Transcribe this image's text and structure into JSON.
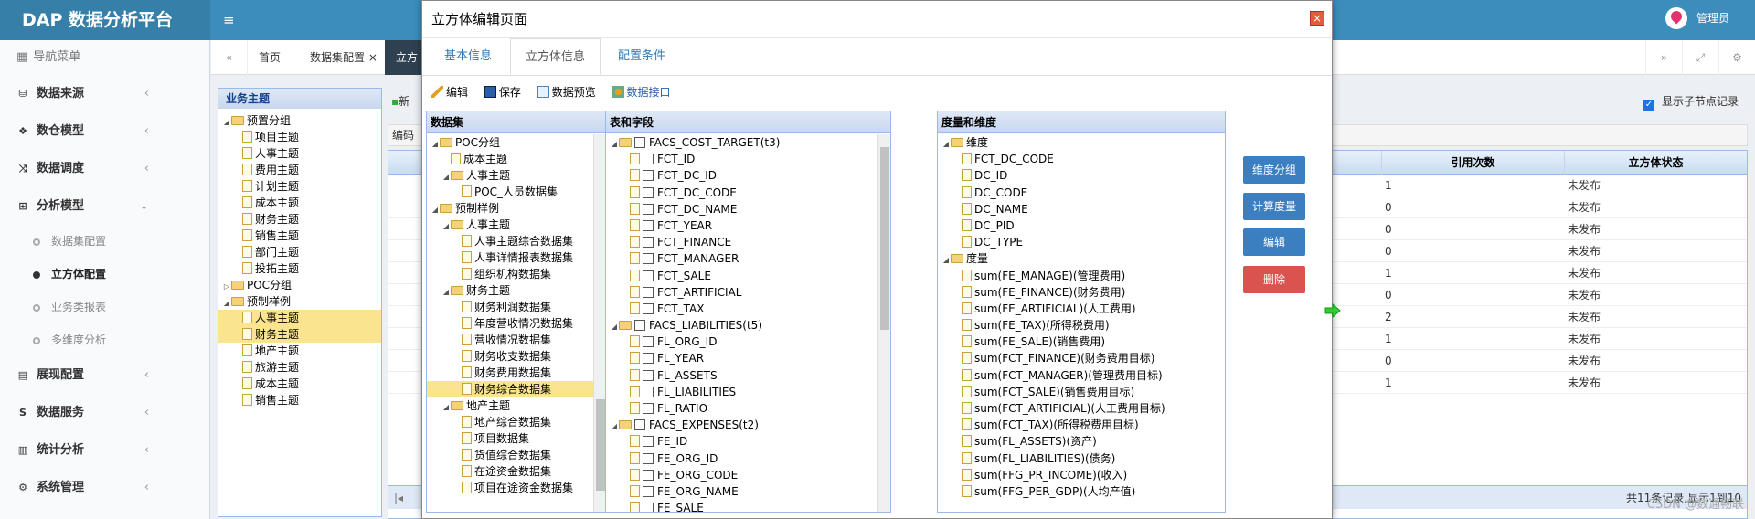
{
  "app": {
    "logo": "DAP 数据分析平台",
    "user": "管理员",
    "menu_icon": "hamburger-icon"
  },
  "sidebar": {
    "header": "导航菜单",
    "items": [
      {
        "label": "数据来源",
        "icon": "database-icon"
      },
      {
        "label": "数仓模型",
        "icon": "cubes-icon"
      },
      {
        "label": "数据调度",
        "icon": "shuffle-icon"
      },
      {
        "label": "分析模型",
        "icon": "sitemap-icon",
        "expanded": true
      },
      {
        "label": "展现配置",
        "icon": "film-icon"
      },
      {
        "label": "数据服务",
        "icon": "dollar-icon"
      },
      {
        "label": "统计分析",
        "icon": "bar-chart-icon"
      },
      {
        "label": "系统管理",
        "icon": "gear-icon"
      }
    ],
    "subitems": [
      {
        "label": "数据集配置",
        "active": false
      },
      {
        "label": "立方体配置",
        "active": true
      },
      {
        "label": "业务类报表",
        "active": false
      },
      {
        "label": "多维度分析",
        "active": false
      }
    ]
  },
  "tabs": {
    "home": "首页",
    "dataset": "数据集配置",
    "cube": "立方"
  },
  "business": {
    "title": "业务主题",
    "tree": [
      {
        "label": "预置分组",
        "level": 0,
        "type": "folder",
        "toggle": "open"
      },
      {
        "label": "项目主题",
        "level": 1,
        "type": "doc"
      },
      {
        "label": "人事主题",
        "level": 1,
        "type": "doc"
      },
      {
        "label": "费用主题",
        "level": 1,
        "type": "doc"
      },
      {
        "label": "计划主题",
        "level": 1,
        "type": "doc"
      },
      {
        "label": "成本主题",
        "level": 1,
        "type": "doc"
      },
      {
        "label": "财务主题",
        "level": 1,
        "type": "doc"
      },
      {
        "label": "销售主题",
        "level": 1,
        "type": "doc"
      },
      {
        "label": "部门主题",
        "level": 1,
        "type": "doc"
      },
      {
        "label": "投拓主题",
        "level": 1,
        "type": "doc"
      },
      {
        "label": "POC分组",
        "level": 0,
        "type": "folder",
        "toggle": "closed"
      },
      {
        "label": "预制样例",
        "level": 0,
        "type": "folder",
        "toggle": "open"
      },
      {
        "label": "人事主题",
        "level": 1,
        "type": "doc",
        "selected": true
      },
      {
        "label": "财务主题",
        "level": 1,
        "type": "doc",
        "selected": true
      },
      {
        "label": "地产主题",
        "level": 1,
        "type": "doc"
      },
      {
        "label": "旅游主题",
        "level": 1,
        "type": "doc"
      },
      {
        "label": "成本主题",
        "level": 1,
        "type": "doc"
      },
      {
        "label": "销售主题",
        "level": 1,
        "type": "doc"
      }
    ]
  },
  "main": {
    "new_btn": "新",
    "code_label": "编码",
    "show_children_label": "显示子节点记录",
    "columns": [
      "引用次数",
      "立方体状态"
    ],
    "rows": [
      {
        "refs": "1",
        "status": "未发布"
      },
      {
        "refs": "0",
        "status": "未发布"
      },
      {
        "refs": "0",
        "status": "未发布"
      },
      {
        "refs": "0",
        "status": "未发布"
      },
      {
        "refs": "1",
        "status": "未发布"
      },
      {
        "refs": "0",
        "status": "未发布"
      },
      {
        "refs": "2",
        "status": "未发布"
      },
      {
        "refs": "1",
        "status": "未发布"
      },
      {
        "refs": "0",
        "status": "未发布"
      },
      {
        "refs": "1",
        "status": "未发布"
      }
    ],
    "pager_text": "共11条记录,显示1到10"
  },
  "modal": {
    "title": "立方体编辑页面",
    "tabs": [
      "基本信息",
      "立方体信息",
      "配置条件"
    ],
    "toolbar": {
      "edit": "编辑",
      "save": "保存",
      "preview": "数据预览",
      "api": "数据接口"
    },
    "dataset_title": "数据集",
    "dataset_tree": [
      {
        "label": "POC分组",
        "level": 0,
        "type": "folder",
        "toggle": "open"
      },
      {
        "label": "成本主题",
        "level": 1,
        "type": "doc"
      },
      {
        "label": "人事主题",
        "level": 1,
        "type": "folder",
        "toggle": "open"
      },
      {
        "label": "POC_人员数据集",
        "level": 2,
        "type": "doc"
      },
      {
        "label": "预制样例",
        "level": 0,
        "type": "folder",
        "toggle": "open"
      },
      {
        "label": "人事主题",
        "level": 1,
        "type": "folder",
        "toggle": "open"
      },
      {
        "label": "人事主题综合数据集",
        "level": 2,
        "type": "doc"
      },
      {
        "label": "人事详情报表数据集",
        "level": 2,
        "type": "doc"
      },
      {
        "label": "组织机构数据集",
        "level": 2,
        "type": "doc"
      },
      {
        "label": "财务主题",
        "level": 1,
        "type": "folder",
        "toggle": "open"
      },
      {
        "label": "财务利润数据集",
        "level": 2,
        "type": "doc"
      },
      {
        "label": "年度营收情况数据集",
        "level": 2,
        "type": "doc"
      },
      {
        "label": "营收情况数据集",
        "level": 2,
        "type": "doc"
      },
      {
        "label": "财务收支数据集",
        "level": 2,
        "type": "doc"
      },
      {
        "label": "财务费用数据集",
        "level": 2,
        "type": "doc"
      },
      {
        "label": "财务综合数据集",
        "level": 2,
        "type": "doc",
        "selected": true
      },
      {
        "label": "地产主题",
        "level": 1,
        "type": "folder",
        "toggle": "open"
      },
      {
        "label": "地产综合数据集",
        "level": 2,
        "type": "doc"
      },
      {
        "label": "项目数据集",
        "level": 2,
        "type": "doc"
      },
      {
        "label": "货值综合数据集",
        "level": 2,
        "type": "doc"
      },
      {
        "label": "在途资金数据集",
        "level": 2,
        "type": "doc"
      },
      {
        "label": "项目在途资金数据集",
        "level": 2,
        "type": "doc"
      }
    ],
    "fields_title": "表和字段",
    "fields_tree": [
      {
        "label": "FACS_COST_TARGET(t3)",
        "level": 0,
        "type": "folder",
        "toggle": "open"
      },
      {
        "label": "FCT_ID",
        "level": 1,
        "type": "doc"
      },
      {
        "label": "FCT_DC_ID",
        "level": 1,
        "type": "doc"
      },
      {
        "label": "FCT_DC_CODE",
        "level": 1,
        "type": "doc"
      },
      {
        "label": "FCT_DC_NAME",
        "level": 1,
        "type": "doc"
      },
      {
        "label": "FCT_YEAR",
        "level": 1,
        "type": "doc"
      },
      {
        "label": "FCT_FINANCE",
        "level": 1,
        "type": "doc"
      },
      {
        "label": "FCT_MANAGER",
        "level": 1,
        "type": "doc"
      },
      {
        "label": "FCT_SALE",
        "level": 1,
        "type": "doc"
      },
      {
        "label": "FCT_ARTIFICIAL",
        "level": 1,
        "type": "doc"
      },
      {
        "label": "FCT_TAX",
        "level": 1,
        "type": "doc"
      },
      {
        "label": "FACS_LIABILITIES(t5)",
        "level": 0,
        "type": "folder",
        "toggle": "open"
      },
      {
        "label": "FL_ORG_ID",
        "level": 1,
        "type": "doc"
      },
      {
        "label": "FL_YEAR",
        "level": 1,
        "type": "doc"
      },
      {
        "label": "FL_ASSETS",
        "level": 1,
        "type": "doc"
      },
      {
        "label": "FL_LIABILITIES",
        "level": 1,
        "type": "doc"
      },
      {
        "label": "FL_RATIO",
        "level": 1,
        "type": "doc"
      },
      {
        "label": "FACS_EXPENSES(t2)",
        "level": 0,
        "type": "folder",
        "toggle": "open"
      },
      {
        "label": "FE_ID",
        "level": 1,
        "type": "doc"
      },
      {
        "label": "FE_ORG_ID",
        "level": 1,
        "type": "doc"
      },
      {
        "label": "FE_ORG_CODE",
        "level": 1,
        "type": "doc"
      },
      {
        "label": "FE_ORG_NAME",
        "level": 1,
        "type": "doc"
      },
      {
        "label": "FE_SALE",
        "level": 1,
        "type": "doc"
      }
    ],
    "measures_title": "度量和维度",
    "measures_tree": [
      {
        "label": "维度",
        "level": 0,
        "type": "folder",
        "toggle": "open"
      },
      {
        "label": "FCT_DC_CODE",
        "level": 1,
        "type": "doc"
      },
      {
        "label": "DC_ID",
        "level": 1,
        "type": "doc"
      },
      {
        "label": "DC_CODE",
        "level": 1,
        "type": "doc"
      },
      {
        "label": "DC_NAME",
        "level": 1,
        "type": "doc"
      },
      {
        "label": "DC_PID",
        "level": 1,
        "type": "doc"
      },
      {
        "label": "DC_TYPE",
        "level": 1,
        "type": "doc"
      },
      {
        "label": "度量",
        "level": 0,
        "type": "folder",
        "toggle": "open"
      },
      {
        "label": "sum(FE_MANAGE)(管理费用)",
        "level": 1,
        "type": "doc"
      },
      {
        "label": "sum(FE_FINANCE)(财务费用)",
        "level": 1,
        "type": "doc"
      },
      {
        "label": "sum(FE_ARTIFICIAL)(人工费用)",
        "level": 1,
        "type": "doc"
      },
      {
        "label": "sum(FE_TAX)(所得税费用)",
        "level": 1,
        "type": "doc"
      },
      {
        "label": "sum(FE_SALE)(销售费用)",
        "level": 1,
        "type": "doc"
      },
      {
        "label": "sum(FCT_FINANCE)(财务费用目标)",
        "level": 1,
        "type": "doc"
      },
      {
        "label": "sum(FCT_MANAGER)(管理费用目标)",
        "level": 1,
        "type": "doc"
      },
      {
        "label": "sum(FCT_SALE)(销售费用目标)",
        "level": 1,
        "type": "doc"
      },
      {
        "label": "sum(FCT_ARTIFICIAL)(人工费用目标)",
        "level": 1,
        "type": "doc"
      },
      {
        "label": "sum(FCT_TAX)(所得税费用目标)",
        "level": 1,
        "type": "doc"
      },
      {
        "label": "sum(FL_ASSETS)(资产)",
        "level": 1,
        "type": "doc"
      },
      {
        "label": "sum(FL_LIABILITIES)(债务)",
        "level": 1,
        "type": "doc"
      },
      {
        "label": "sum(FFG_PR_INCOME)(收入)",
        "level": 1,
        "type": "doc"
      },
      {
        "label": "sum(FFG_PER_GDP)(人均产值)",
        "level": 1,
        "type": "doc"
      }
    ],
    "buttons": {
      "dim_group": "维度分组",
      "calc_measure": "计算度量",
      "edit": "编辑",
      "delete": "删除"
    },
    "colors": {
      "primary": "#3c7fc1",
      "danger": "#d9534f"
    }
  },
  "watermark": "CSDN @数通畅联"
}
